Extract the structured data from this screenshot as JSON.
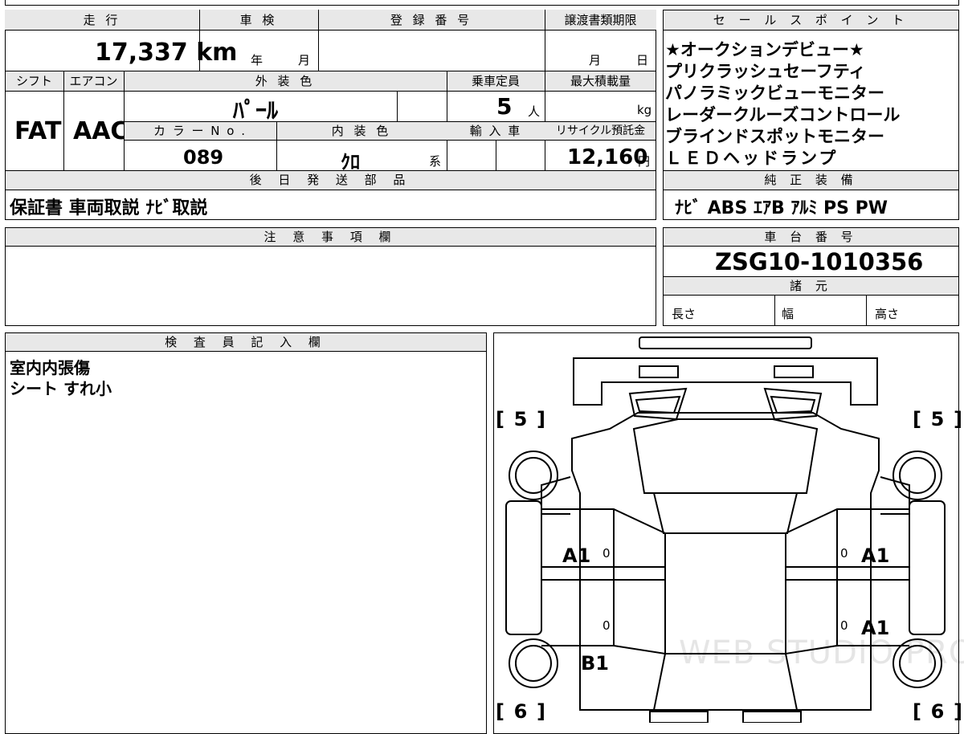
{
  "top_strip": {
    "partial_text": "..."
  },
  "main": {
    "headers": {
      "mileage": "走 行",
      "inspection": "車 検",
      "registration": "登 録 番 号",
      "transfer_deadline": "譲渡書類期限",
      "shift": "シフト",
      "aircon": "エアコン",
      "exterior_color": "外 装 色",
      "capacity": "乗車定員",
      "max_load": "最大積載量",
      "color_no": "カ ラ ー N o .",
      "interior_color": "内 装 色",
      "import": "輸 入 車",
      "recycle_fee": "リサイクル預託金",
      "parts_to_send": "後 日 発 送 部 品"
    },
    "mileage_value": "17,337 km",
    "inspection_year_unit": "年",
    "inspection_month_unit": "月",
    "deadline_month_unit": "月",
    "deadline_day_unit": "日",
    "shift_value": "FAT",
    "aircon_value": "AAC",
    "exterior_color_value": "ﾊﾟｰﾙ",
    "capacity_value": "5",
    "capacity_unit": "人",
    "max_load_unit": "kg",
    "color_no_value": "089",
    "interior_color_value": "ｸﾛ",
    "interior_color_suffix": "系",
    "recycle_fee_value": "12,160",
    "recycle_fee_unit": "円",
    "parts_to_send_value": "保証書 車両取説 ﾅﾋﾞ取説"
  },
  "sales_points": {
    "header": "セ ー ル ス ポ イ ン ト",
    "lines": [
      "★オークションデビュー★",
      "プリクラッシュセーフティ",
      "パノラミックビューモニター",
      "レーダークルーズコントロール",
      "ブラインドスポットモニター",
      "ＬＥＤヘッドランプ"
    ]
  },
  "standard_equipment": {
    "header": "純 正 装 備",
    "value": "ﾅﾋﾞ ABS ｴｱB ｱﾙﾐ PS PW"
  },
  "notes": {
    "header": "注 意 事 項 欄"
  },
  "chassis": {
    "header": "車 台 番 号",
    "value": "ZSG10-1010356",
    "specs_header": "諸 元",
    "length_label": "長さ",
    "width_label": "幅",
    "height_label": "高さ"
  },
  "inspector": {
    "header": "検 査 員 記 入 欄",
    "lines": [
      "室内内張傷",
      "シート すれ小"
    ]
  },
  "diagram": {
    "tire_left_front": "5",
    "tire_right_front": "5",
    "tire_left_rear": "6",
    "tire_right_rear": "6",
    "mark_front_left_door": "A1",
    "mark_front_right_door": "A1",
    "mark_rear_right_door": "A1",
    "mark_rear_left_quarter": "B1",
    "small_marks": [
      "0",
      "0",
      "0",
      "0"
    ],
    "watermark": "WEB STUDIO PRO"
  }
}
